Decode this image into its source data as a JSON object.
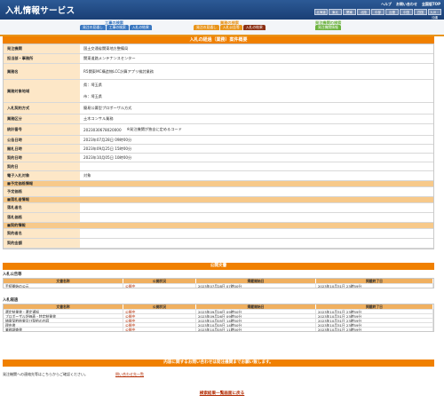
{
  "header": {
    "title": "入札情報サービス",
    "links": [
      "ヘルプ",
      "お問い合わせ",
      "全国版TOP"
    ],
    "regions": [
      "北海道",
      "東北",
      "関東",
      "北陸",
      "中部",
      "近畿",
      "中国",
      "四国",
      "九州・沖縄"
    ]
  },
  "groups": [
    {
      "title": "工事の検索",
      "tabs": [
        "発注の見通し",
        "工事の検索",
        "入札の結果"
      ]
    },
    {
      "title": "業務の検索",
      "tabs": [
        "発注の見通し",
        "入札公告等",
        "入札の結果"
      ]
    },
    {
      "title": "発注機関の検索",
      "tabs": [
        "発注機関情報"
      ]
    }
  ],
  "main": {
    "title": "入札の経過（業務）案件概要",
    "rows": [
      {
        "k": "発注機関",
        "v": "国土交通省関東地方整備局"
      },
      {
        "k": "担当部・事務所",
        "v": "関東道路メンテナンスセンター"
      },
      {
        "k": "業務名",
        "v": "R5関東MC構造物LCC計算アプリ検討業務"
      },
      {
        "k": "業務対象地域",
        "v": "県：埼玉県",
        "v2": "市：埼玉県"
      },
      {
        "k": "入札契約方式",
        "v": "簡易公募型プロポーザル方式"
      },
      {
        "k": "業務区分",
        "v": "土木コンサル業務"
      },
      {
        "k": "統計番号",
        "v": "2023030678020000",
        "v2": "※発注機関が独自に定めるコード"
      },
      {
        "k": "公告日時",
        "v": "2023年07月28日 09時00分"
      },
      {
        "k": "開札日時",
        "v": "2023年09月25日 15時00分"
      },
      {
        "k": "契約日時",
        "v": "2023年10月05日 10時00分"
      },
      {
        "k": "契約日",
        "v": ""
      },
      {
        "k": "電子入札対象",
        "v": "対象"
      }
    ],
    "sections": [
      {
        "head": "■予定価格情報",
        "rows": [
          {
            "k": "予定価格",
            "v": ""
          }
        ]
      },
      {
        "head": "■落札者情報",
        "rows": [
          {
            "k": "落札者名",
            "v": ""
          },
          {
            "k": "落札価格",
            "v": ""
          }
        ]
      },
      {
        "head": "■契約情報",
        "rows": [
          {
            "k": "契約者名",
            "v": ""
          },
          {
            "k": "契約金額",
            "v": ""
          }
        ]
      }
    ]
  },
  "attachments": {
    "title": "公開文書",
    "columns": [
      "文書名称",
      "公開状況",
      "掲載開始日",
      "掲載終了日"
    ],
    "kokoku": {
      "label": "入札公告等",
      "rows": [
        {
          "name": "手続開始の公示",
          "status": "公開中",
          "start": "2023年07月28日 07時00分",
          "end": "2023年10月31日 23時59分"
        }
      ]
    },
    "kekka": {
      "label": "入札経過",
      "rows": [
        {
          "name": "選定結果書・選定通知",
          "status": "公開中",
          "start": "2023年09月26日 09時50分",
          "end": "2023年10月31日 23時59分"
        },
        {
          "name": "プロポーザル評価表・特定結果書",
          "status": "公開中",
          "start": "2023年09月26日 09時50分",
          "end": "2023年10月31日 23時59分"
        },
        {
          "name": "随意契約結果及び契約の内容",
          "status": "公開中",
          "start": "2023年10月05日 14時50分",
          "end": "2023年10月31日 23時59分"
        },
        {
          "name": "理由書",
          "status": "公開中",
          "start": "2023年10月05日 14時50分",
          "end": "2023年10月31日 23時59分"
        },
        {
          "name": "業務調査書",
          "status": "公開中",
          "start": "2023年10月05日 11時00分",
          "end": "2023年10月31日 23時59分"
        }
      ]
    }
  },
  "contact": {
    "bar": "内容に関するお問い合わせは発注機関までお願い致します。",
    "note": "発注機関への連絡先等はこちらからご確認ください。",
    "link": "問い合わせ先一覧"
  },
  "back": "検索結果一覧画面に戻る"
}
